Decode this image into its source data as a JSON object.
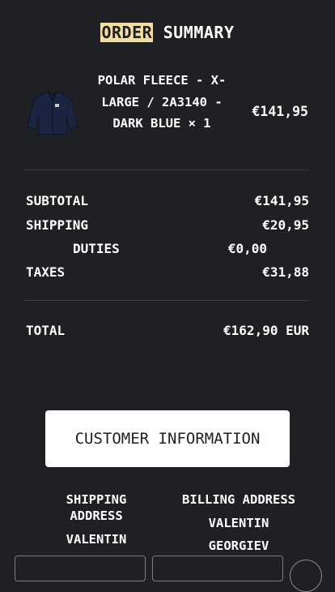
{
  "header": {
    "title_highlight": "ORDER",
    "title_rest": " SUMMARY"
  },
  "item": {
    "name": "POLAR FLEECE - X-LARGE / 2A3140 - DARK BLUE × 1",
    "price": "€141,95",
    "image_icon": "jacket-image"
  },
  "totals": {
    "subtotal_label": "SUBTOTAL",
    "subtotal_value": "€141,95",
    "shipping_label": "SHIPPING",
    "shipping_value": "€20,95",
    "duties_label": "DUTIES",
    "duties_value": "€0,00",
    "taxes_label": "TAXES",
    "taxes_value": "€31,88",
    "total_label": "TOTAL",
    "total_value": "€162,90 EUR"
  },
  "customer": {
    "button_label": "CUSTOMER INFORMATION",
    "shipping_heading": "SHIPPING ADDRESS",
    "shipping_first_name": "VALENTIN",
    "billing_heading": "BILLING ADDRESS",
    "billing_first_name": "VALENTIN",
    "billing_last_name": "GEORGIEV"
  },
  "colors": {
    "background": "#1f2024",
    "highlight": "#f3dfa2",
    "text": "#ffffff"
  }
}
